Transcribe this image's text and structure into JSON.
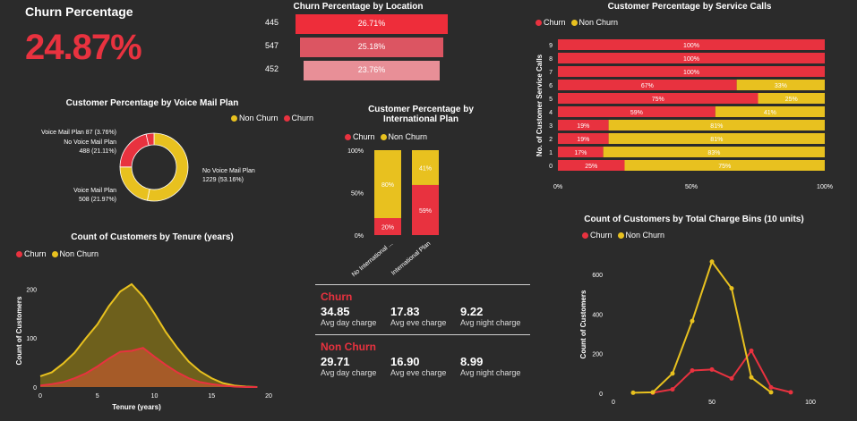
{
  "colors": {
    "churn": "#e8323f",
    "non_churn": "#e8c11f",
    "bg": "#2b2b2b"
  },
  "kpi": {
    "title": "Churn Percentage",
    "value": "24.87%"
  },
  "location": {
    "title": "Churn Percentage by Location",
    "rows": [
      {
        "label": "445",
        "value_label": "26.71%",
        "value": 26.71,
        "color": "#ee2d3a"
      },
      {
        "label": "547",
        "value_label": "25.18%",
        "value": 25.18,
        "color": "#dc5562"
      },
      {
        "label": "452",
        "value_label": "23.76%",
        "value": 23.76,
        "color": "#e88f97"
      }
    ]
  },
  "chart_data": [
    {
      "type": "pie",
      "title": "Customer Percentage by Voice Mail Plan",
      "legend": [
        "Non Churn",
        "Churn"
      ],
      "slices": [
        {
          "label_line1": "No Voice Mail Plan",
          "label_line2": "1229 (53.16%)",
          "value": 1229,
          "color": "#e8c11f"
        },
        {
          "label_line1": "Voice Mail Plan",
          "label_line2": "508 (21.97%)",
          "value": 508,
          "color": "#e8c11f"
        },
        {
          "label_line1": "No Voice Mail Plan",
          "label_line2": "488 (21.11%)",
          "value": 488,
          "color": "#e8323f"
        },
        {
          "label_line1": "Voice Mail Plan 87 (3.76%)",
          "label_line2": "",
          "value": 87,
          "color": "#e8323f"
        }
      ]
    },
    {
      "type": "bar",
      "title": "Customer Percentage by International Plan",
      "title_line1": "Customer Percentage by",
      "title_line2": "International Plan",
      "legend": [
        "Churn",
        "Non Churn"
      ],
      "categories": [
        "No International ...",
        "International Plan"
      ],
      "series": [
        {
          "name": "Churn",
          "values": [
            20,
            59
          ],
          "labels": [
            "20%",
            "59%"
          ]
        },
        {
          "name": "Non Churn",
          "values": [
            80,
            41
          ],
          "labels": [
            "80%",
            "41%"
          ]
        }
      ],
      "yticks": [
        "0%",
        "50%",
        "100%"
      ],
      "ylim": [
        0,
        100
      ]
    },
    {
      "type": "bar",
      "title": "Customer Percentage by Service Calls",
      "legend": [
        "Churn",
        "Non Churn"
      ],
      "ylabel": "No. of Customer Service Calls",
      "categories": [
        "9",
        "8",
        "7",
        "6",
        "5",
        "4",
        "3",
        "2",
        "1",
        "0"
      ],
      "series": [
        {
          "name": "Churn",
          "values": [
            100,
            100,
            100,
            67,
            75,
            59,
            19,
            19,
            17,
            25
          ],
          "labels": [
            "100%",
            "100%",
            "100%",
            "67%",
            "75%",
            "59%",
            "19%",
            "19%",
            "17%",
            "25%"
          ]
        },
        {
          "name": "Non Churn",
          "values": [
            0,
            0,
            0,
            33,
            25,
            41,
            81,
            81,
            83,
            75
          ],
          "labels": [
            "",
            "",
            "",
            "33%",
            "25%",
            "41%",
            "81%",
            "81%",
            "83%",
            "75%"
          ]
        }
      ],
      "xticks": [
        "0%",
        "50%",
        "100%"
      ],
      "xlim": [
        0,
        100
      ]
    },
    {
      "type": "area",
      "title": "Count of Customers by Tenure (years)",
      "legend": [
        "Churn",
        "Non Churn"
      ],
      "xlabel": "Tenure (years)",
      "ylabel": "Count of Customers",
      "xlim": [
        0,
        20
      ],
      "ylim": [
        0,
        230
      ],
      "xticks": [
        "0",
        "5",
        "10",
        "15",
        "20"
      ],
      "yticks": [
        "0",
        "100",
        "200"
      ],
      "x": [
        0,
        1,
        2,
        3,
        4,
        5,
        6,
        7,
        8,
        9,
        10,
        11,
        12,
        13,
        14,
        15,
        16,
        17,
        18,
        19
      ],
      "series": [
        {
          "name": "Non Churn",
          "values": [
            22,
            30,
            48,
            70,
            100,
            128,
            165,
            195,
            210,
            185,
            150,
            112,
            80,
            52,
            32,
            18,
            8,
            3,
            1,
            0
          ]
        },
        {
          "name": "Churn",
          "values": [
            3,
            6,
            10,
            18,
            28,
            42,
            58,
            72,
            74,
            80,
            62,
            45,
            30,
            18,
            10,
            6,
            3,
            1,
            0,
            0
          ]
        }
      ]
    },
    {
      "type": "line",
      "title": "Count of Customers by Total Charge Bins (10 units)",
      "legend": [
        "Churn",
        "Non Churn"
      ],
      "ylabel": "Count of Customers",
      "xlim": [
        0,
        100
      ],
      "ylim": [
        0,
        700
      ],
      "xticks": [
        "0",
        "50",
        "100"
      ],
      "yticks": [
        "0",
        "200",
        "400",
        "600"
      ],
      "series": [
        {
          "name": "Churn",
          "x": [
            20,
            30,
            40,
            50,
            60,
            70,
            80,
            90
          ],
          "values": [
            3,
            20,
            115,
            120,
            75,
            215,
            30,
            5
          ]
        },
        {
          "name": "Non Churn",
          "x": [
            10,
            20,
            30,
            40,
            50,
            60,
            70,
            80
          ],
          "values": [
            3,
            5,
            100,
            365,
            665,
            530,
            80,
            5
          ]
        }
      ]
    }
  ],
  "summary": {
    "churn_title": "Churn",
    "churn": [
      {
        "value": "34.85",
        "label": "Avg day charge"
      },
      {
        "value": "17.83",
        "label": "Avg eve charge"
      },
      {
        "value": "9.22",
        "label": "Avg night charge"
      }
    ],
    "nonchurn_title": "Non Churn",
    "nonchurn": [
      {
        "value": "29.71",
        "label": "Avg day charge"
      },
      {
        "value": "16.90",
        "label": "Avg eve charge"
      },
      {
        "value": "8.99",
        "label": "Avg night charge"
      }
    ]
  }
}
